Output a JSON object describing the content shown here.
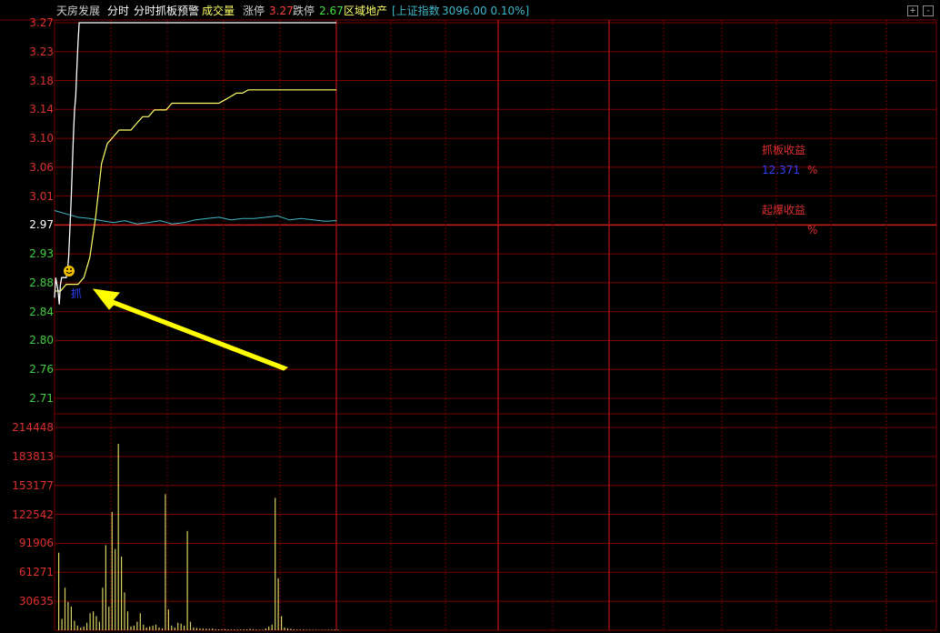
{
  "header": {
    "stock_name": "天房发展",
    "tab_intraday": "分时",
    "tab_alert": "分时抓板预警",
    "volume_label": "成交量",
    "limit_up_label": "涨停",
    "limit_up_value": "3.27",
    "limit_down_label": "跌停",
    "limit_down_value": "2.67",
    "sector": "区域地产",
    "index_text": "[上证指数",
    "index_value": "3096.00 0.10%]",
    "btn_plus": "+",
    "btn_minus": "-"
  },
  "price_axis": [
    "3.27",
    "3.23",
    "3.18",
    "3.14",
    "3.10",
    "3.06",
    "3.01",
    "2.97",
    "2.93",
    "2.88",
    "2.84",
    "2.80",
    "2.76",
    "2.71"
  ],
  "volume_axis": [
    "214448",
    "183813",
    "153177",
    "122542",
    "91906",
    "61271",
    "30635"
  ],
  "signal": {
    "buy_marker": "抓"
  },
  "side_panel": {
    "grab_profit_label": "抓板收益",
    "grab_profit_value": "12.371",
    "grab_profit_unit": "%",
    "burst_profit_label": "起爆收益",
    "burst_profit_unit": "%"
  },
  "colors": {
    "grid_red": "#7a0000",
    "axis_red": "#e03030",
    "price_line": "#ffffff",
    "avg_line": "#ffff66",
    "index_line": "#3fb8c8",
    "volume_bar": "#d8d060",
    "arrow": "#ffff00"
  },
  "chart_data": {
    "type": "line",
    "price": {
      "name": "price",
      "x": [
        0,
        1,
        2,
        3,
        4,
        5,
        6,
        7,
        8,
        9,
        10,
        11,
        12,
        13,
        14,
        15,
        16,
        17,
        18,
        19,
        20,
        21,
        22,
        23,
        24,
        25,
        26,
        27,
        28,
        29,
        30,
        31,
        32,
        33,
        34,
        35,
        40,
        50,
        60,
        70,
        80,
        90,
        100,
        110,
        120,
        130,
        140,
        150,
        160,
        170,
        180,
        190,
        200,
        210,
        220,
        230,
        240
      ],
      "values": [
        2.86,
        2.89,
        2.88,
        2.87,
        2.85,
        2.88,
        2.89,
        2.89,
        2.89,
        2.89,
        2.89,
        2.9,
        2.92,
        2.96,
        3.0,
        3.05,
        3.1,
        3.14,
        3.16,
        3.2,
        3.24,
        3.27,
        3.27,
        3.27,
        3.27,
        3.27,
        3.27,
        3.27,
        3.27,
        3.27,
        3.27,
        3.27,
        3.27,
        3.27,
        3.27,
        3.27,
        3.27,
        3.27,
        3.27,
        3.27,
        3.27,
        3.27,
        3.27,
        3.27,
        3.27,
        3.27,
        3.27,
        3.27,
        3.27,
        3.27,
        3.27,
        3.27,
        3.27,
        3.27,
        3.27,
        3.27,
        3.27
      ]
    },
    "avg": {
      "name": "average",
      "x": [
        0,
        5,
        10,
        15,
        20,
        25,
        30,
        35,
        40,
        45,
        50,
        55,
        60,
        65,
        70,
        75,
        80,
        85,
        90,
        95,
        100,
        105,
        110,
        115,
        120,
        125,
        130,
        135,
        140,
        145,
        150,
        155,
        160,
        165,
        170,
        180,
        190,
        200,
        210,
        220,
        230,
        240
      ],
      "values": [
        2.87,
        2.87,
        2.88,
        2.88,
        2.88,
        2.89,
        2.92,
        2.98,
        3.06,
        3.09,
        3.1,
        3.11,
        3.11,
        3.11,
        3.12,
        3.13,
        3.13,
        3.14,
        3.14,
        3.14,
        3.15,
        3.15,
        3.15,
        3.15,
        3.15,
        3.15,
        3.15,
        3.15,
        3.15,
        3.155,
        3.16,
        3.165,
        3.165,
        3.17,
        3.17,
        3.17,
        3.17,
        3.17,
        3.17,
        3.17,
        3.17,
        3.17
      ]
    },
    "index": {
      "name": "index",
      "x": [
        0,
        10,
        20,
        30,
        40,
        50,
        60,
        70,
        80,
        90,
        100,
        110,
        120,
        130,
        140,
        150,
        160,
        170,
        180,
        190,
        200,
        210,
        220,
        230,
        240
      ],
      "values": [
        2.99,
        2.985,
        2.98,
        2.978,
        2.975,
        2.972,
        2.975,
        2.97,
        2.972,
        2.975,
        2.97,
        2.972,
        2.976,
        2.978,
        2.98,
        2.976,
        2.978,
        2.978,
        2.98,
        2.982,
        2.976,
        2.978,
        2.976,
        2.974,
        2.975
      ]
    },
    "volume": {
      "name": "volume",
      "values": [
        82000,
        12000,
        45000,
        30000,
        25000,
        10000,
        5000,
        3000,
        4000,
        8000,
        18000,
        20000,
        15000,
        9000,
        45000,
        90000,
        25000,
        125000,
        86000,
        197000,
        78000,
        40000,
        20000,
        4000,
        5000,
        9000,
        18000,
        6000,
        3000,
        4000,
        5000,
        6000,
        3000,
        2000,
        144000,
        22000,
        5000,
        3000,
        8000,
        7000,
        5000,
        105000,
        9000,
        3000,
        2500,
        2000,
        2000,
        1500,
        1500,
        1800,
        1200,
        1000,
        1000,
        1200,
        1000,
        900,
        900,
        900,
        800,
        900,
        1000,
        1500,
        1200,
        800,
        700,
        600,
        2000,
        4000,
        6000,
        140000,
        55000,
        15000,
        3000,
        2000,
        1500,
        1000,
        800,
        800,
        700,
        600,
        600,
        500,
        500,
        500,
        500,
        500,
        600,
        700,
        800,
        600
      ],
      "ylim": [
        0,
        214448
      ]
    },
    "ylim": [
      2.71,
      3.27
    ],
    "ytick_labels": [
      "3.27",
      "3.23",
      "3.18",
      "3.14",
      "3.10",
      "3.06",
      "3.01",
      "2.97",
      "2.93",
      "2.88",
      "2.84",
      "2.80",
      "2.76",
      "2.71"
    ]
  }
}
